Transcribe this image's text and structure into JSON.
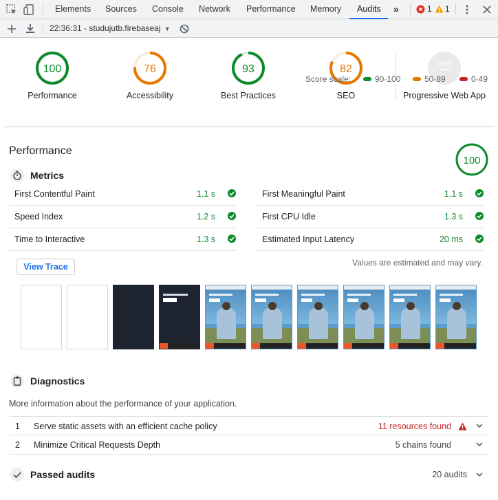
{
  "devtools": {
    "tabs": [
      "Elements",
      "Sources",
      "Console",
      "Network",
      "Performance",
      "Memory",
      "Audits"
    ],
    "active_tab": "Audits",
    "error_count": "1",
    "warning_count": "1"
  },
  "audit_toolbar": {
    "report": "22:36:31 - studujutb.firebaseaj"
  },
  "gauges": [
    {
      "label": "Performance",
      "score": "100",
      "value": 100,
      "color": "#0d8a2a",
      "track": "#ddf0e1"
    },
    {
      "label": "Accessibility",
      "score": "76",
      "value": 76,
      "color": "#e67700",
      "track": "#fcebd8"
    },
    {
      "label": "Best Practices",
      "score": "93",
      "value": 93,
      "color": "#0d8a2a",
      "track": "#ddf0e1"
    },
    {
      "label": "SEO",
      "score": "82",
      "value": 82,
      "color": "#e67700",
      "track": "#fcebd8"
    },
    {
      "label": "Progressive Web App",
      "badge": "PWA"
    }
  ],
  "score_scale": {
    "label": "Score scale:",
    "ranges": [
      {
        "label": "90-100",
        "color": "#0d8a2a"
      },
      {
        "label": "50-89",
        "color": "#e67700"
      },
      {
        "label": "0-49",
        "color": "#c7221f"
      }
    ]
  },
  "performance": {
    "title": "Performance",
    "score": "100",
    "metrics_title": "Metrics",
    "metrics": [
      {
        "name": "First Contentful Paint",
        "value": "1.1 s"
      },
      {
        "name": "First Meaningful Paint",
        "value": "1.1 s"
      },
      {
        "name": "Speed Index",
        "value": "1.2 s"
      },
      {
        "name": "First CPU Idle",
        "value": "1.3 s"
      },
      {
        "name": "Time to Interactive",
        "value": "1.3 s"
      },
      {
        "name": "Estimated Input Latency",
        "value": "20 ms"
      }
    ],
    "view_trace_label": "View Trace",
    "values_note": "Values are estimated and may vary."
  },
  "diagnostics": {
    "title": "Diagnostics",
    "description": "More information about the performance of your application.",
    "items": [
      {
        "num": "1",
        "title": "Serve static assets with an efficient cache policy",
        "detail": "11 resources found",
        "detail_color": "#c7221f"
      },
      {
        "num": "2",
        "title": "Minimize Critical Requests Depth",
        "detail": "5 chains found",
        "detail_color": "#424242"
      }
    ]
  },
  "passed_audits": {
    "title": "Passed audits",
    "count": "20 audits"
  }
}
